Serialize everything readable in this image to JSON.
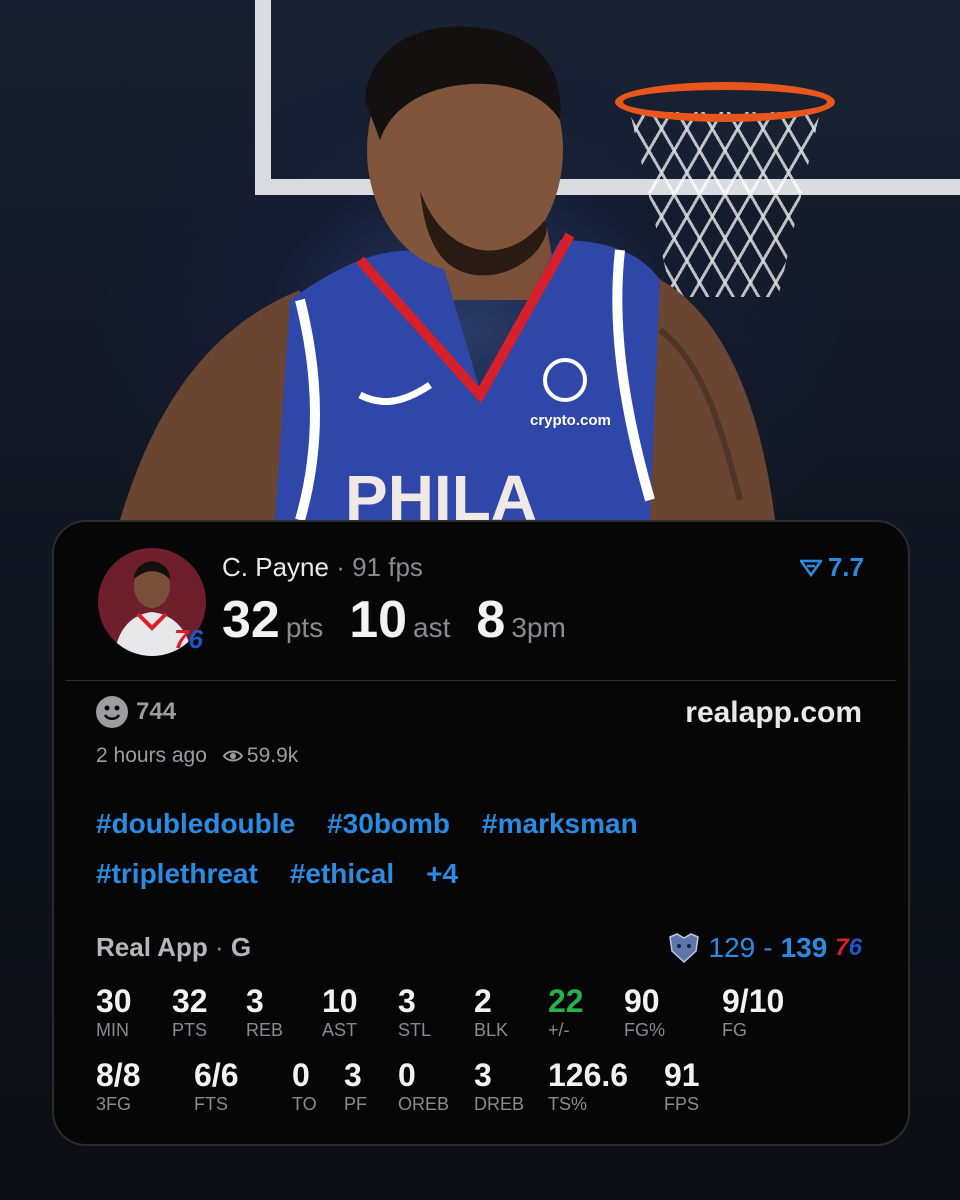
{
  "player": {
    "name": "C. Payne",
    "separator": "·",
    "fps_label": "91 fps",
    "rating": "7.7",
    "avatar_badge_a": "7",
    "avatar_badge_b": "6",
    "headline": [
      {
        "value": "32",
        "unit": "pts"
      },
      {
        "value": "10",
        "unit": "ast"
      },
      {
        "value": "8",
        "unit": "3pm"
      }
    ]
  },
  "social": {
    "reactions": "744",
    "site": "realapp.com",
    "posted": "2 hours ago",
    "views": "59.9k"
  },
  "tags": {
    "row1": [
      "#doubledouble",
      "#30bomb",
      "#marksman"
    ],
    "row2": [
      "#triplethreat",
      "#ethical",
      "+4"
    ]
  },
  "game": {
    "source": "Real App",
    "separator": "·",
    "position": "G",
    "away_score": "129",
    "dash": "-",
    "home_score": "139",
    "home_logo_a": "7",
    "home_logo_b": "6"
  },
  "box": {
    "row1": [
      {
        "value": "30",
        "label": "MIN"
      },
      {
        "value": "32",
        "label": "PTS"
      },
      {
        "value": "3",
        "label": "REB"
      },
      {
        "value": "10",
        "label": "AST"
      },
      {
        "value": "3",
        "label": "STL"
      },
      {
        "value": "2",
        "label": "BLK"
      },
      {
        "value": "22",
        "label": "+/-"
      },
      {
        "value": "90",
        "label": "FG%"
      },
      {
        "value": "9/10",
        "label": "FG"
      }
    ],
    "row2": [
      {
        "value": "8/8",
        "label": "3FG"
      },
      {
        "value": "6/6",
        "label": "FTS"
      },
      {
        "value": "0",
        "label": "TO"
      },
      {
        "value": "3",
        "label": "PF"
      },
      {
        "value": "0",
        "label": "OREB"
      },
      {
        "value": "3",
        "label": "DREB"
      },
      {
        "value": "126.6",
        "label": "TS%"
      },
      {
        "value": "91",
        "label": "FPS"
      }
    ]
  },
  "colors": {
    "accent_blue": "#2b8be0",
    "plus_minus_green": "#27b34a",
    "card_bg": "#060607",
    "sixers_red": "#d6202a",
    "sixers_blue": "#1d57c7"
  }
}
